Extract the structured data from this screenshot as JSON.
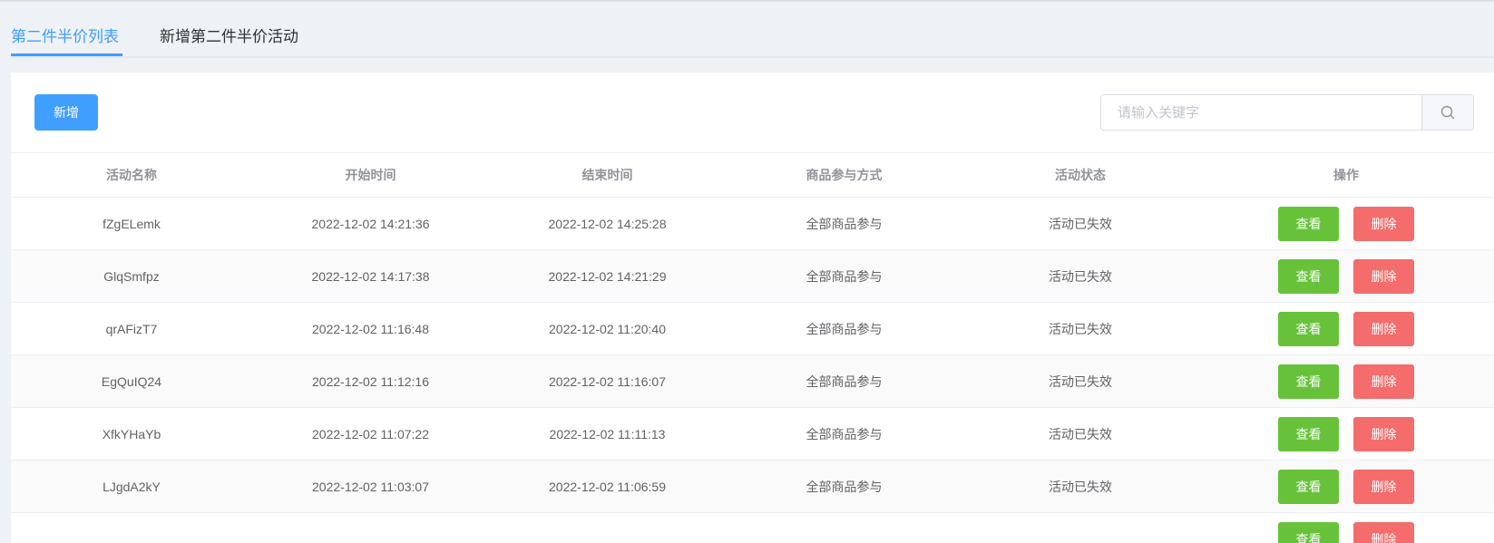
{
  "tabs": [
    {
      "label": "第二件半价列表",
      "active": true
    },
    {
      "label": "新增第二件半价活动",
      "active": false
    }
  ],
  "toolbar": {
    "add_label": "新增"
  },
  "search": {
    "placeholder": "请输入关键字",
    "value": ""
  },
  "table": {
    "headers": [
      "活动名称",
      "开始时间",
      "结束时间",
      "商品参与方式",
      "活动状态",
      "操作"
    ],
    "view_label": "查看",
    "delete_label": "删除",
    "rows": [
      {
        "name": "fZgELemk",
        "start": "2022-12-02 14:21:36",
        "end": "2022-12-02 14:25:28",
        "mode": "全部商品参与",
        "status": "活动已失效"
      },
      {
        "name": "GlqSmfpz",
        "start": "2022-12-02 14:17:38",
        "end": "2022-12-02 14:21:29",
        "mode": "全部商品参与",
        "status": "活动已失效"
      },
      {
        "name": "qrAFizT7",
        "start": "2022-12-02 11:16:48",
        "end": "2022-12-02 11:20:40",
        "mode": "全部商品参与",
        "status": "活动已失效"
      },
      {
        "name": "EgQuIQ24",
        "start": "2022-12-02 11:12:16",
        "end": "2022-12-02 11:16:07",
        "mode": "全部商品参与",
        "status": "活动已失效"
      },
      {
        "name": "XfkYHaYb",
        "start": "2022-12-02 11:07:22",
        "end": "2022-12-02 11:11:13",
        "mode": "全部商品参与",
        "status": "活动已失效"
      },
      {
        "name": "LJgdA2kY",
        "start": "2022-12-02 11:03:07",
        "end": "2022-12-02 11:06:59",
        "mode": "全部商品参与",
        "status": "活动已失效"
      },
      {
        "name": "",
        "start": "",
        "end": "",
        "mode": "",
        "status": ""
      }
    ]
  },
  "colors": {
    "primary": "#409eff",
    "success": "#67c23a",
    "danger": "#f56c6c"
  },
  "icons": {
    "search": "search-icon"
  }
}
